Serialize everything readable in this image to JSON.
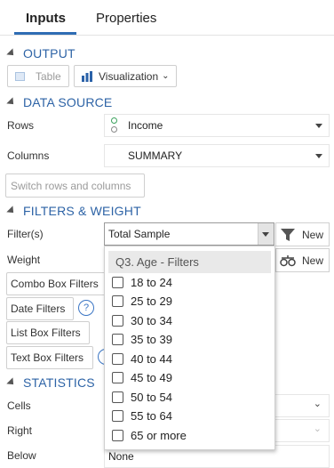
{
  "tabs": [
    {
      "label": "Inputs"
    },
    {
      "label": "Properties"
    }
  ],
  "output": {
    "title": "OUTPUT",
    "table_label": "Table",
    "visualization_label": "Visualization"
  },
  "data_source": {
    "title": "DATA SOURCE",
    "rows_label": "Rows",
    "rows_value": "Income",
    "columns_label": "Columns",
    "columns_value": "SUMMARY",
    "switch_label": "Switch rows and columns"
  },
  "filters_weight": {
    "title": "FILTERS & WEIGHT",
    "filters_label": "Filter(s)",
    "filters_value": "Total Sample",
    "new_label": "New",
    "weight_label": "Weight",
    "weight_new_label": "New",
    "filter_buttons": [
      "Combo Box Filters",
      "Date Filters",
      "List Box Filters",
      "Text Box Filters"
    ],
    "help": "?"
  },
  "dropdown": {
    "header": "Q3. Age - Filters",
    "items": [
      "18 to 24",
      "25 to 29",
      "30 to 34",
      "35 to 39",
      "40 to 44",
      "45 to 49",
      "50 to 54",
      "55 to 64",
      "65 or more"
    ]
  },
  "statistics": {
    "title": "STATISTICS",
    "cells_label": "Cells",
    "right_label": "Right",
    "below_label": "Below",
    "below_value": "None"
  },
  "colors": {
    "accent": "#2d63a6",
    "tab_underline": "#2f6db4"
  }
}
